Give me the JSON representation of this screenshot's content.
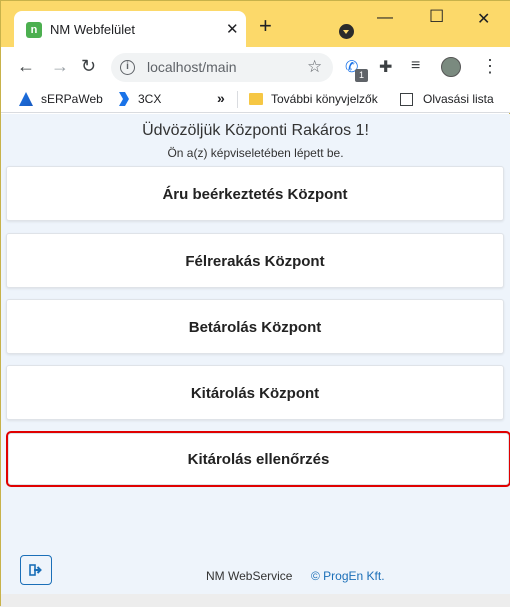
{
  "browser": {
    "tab_title": "NM Webfelület",
    "favicon_letter": "n",
    "url": "localhost/main",
    "phone_badge": "1",
    "bookmarks": [
      "sERPaWeb",
      "3CX",
      "»",
      "További könyvjelzők",
      "Olvasási lista"
    ]
  },
  "page": {
    "welcome": "Üdvözöljük Központi Rakáros 1!",
    "subwelcome": "Ön a(z) képviseletében lépett be.",
    "menu": [
      "Áru beérkeztetés Központ",
      "Félrerakás Központ",
      "Betárolás Központ",
      "Kitárolás Központ",
      "Kitárolás ellenőrzés"
    ],
    "footer_left": "NM WebService",
    "footer_right": "© ProgEn Kft."
  },
  "colors": {
    "tabbar": "#fcd96a",
    "page_bg": "#eef4fb",
    "accent": "#1b6fb8",
    "highlight": "#e00000"
  }
}
